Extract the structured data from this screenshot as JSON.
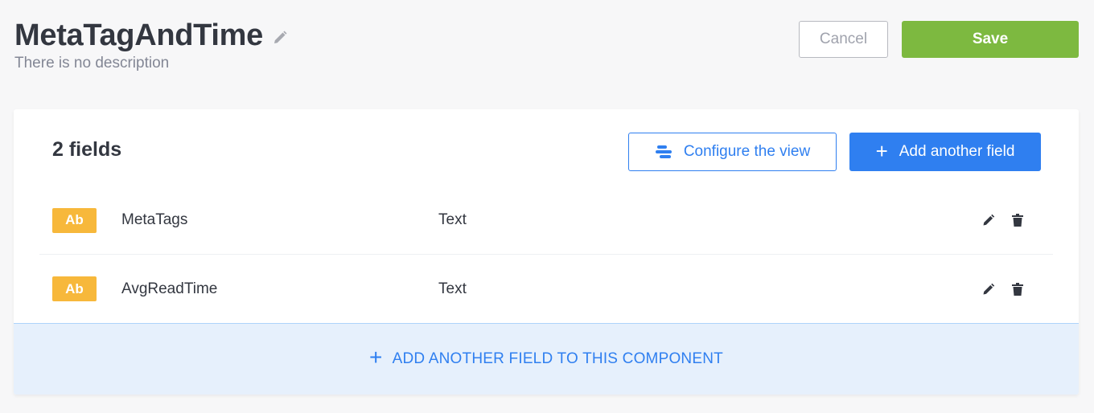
{
  "header": {
    "title": "MetaTagAndTime",
    "description": "There is no description",
    "edit_icon": "pencil-icon"
  },
  "actions": {
    "cancel_label": "Cancel",
    "save_label": "Save"
  },
  "card": {
    "fields_count": "2 fields",
    "configure_label": "Configure the view",
    "add_field_label": "Add another field",
    "add_component_label": "ADD ANOTHER FIELD TO THIS COMPONENT",
    "plus_glyph": "+",
    "fields": [
      {
        "badge": "Ab",
        "name": "MetaTags",
        "type": "Text"
      },
      {
        "badge": "Ab",
        "name": "AvgReadTime",
        "type": "Text"
      }
    ]
  },
  "colors": {
    "primary": "#2f7ff0",
    "save": "#7db940",
    "badge": "#f7b83b",
    "background": "#f7f7f8"
  }
}
